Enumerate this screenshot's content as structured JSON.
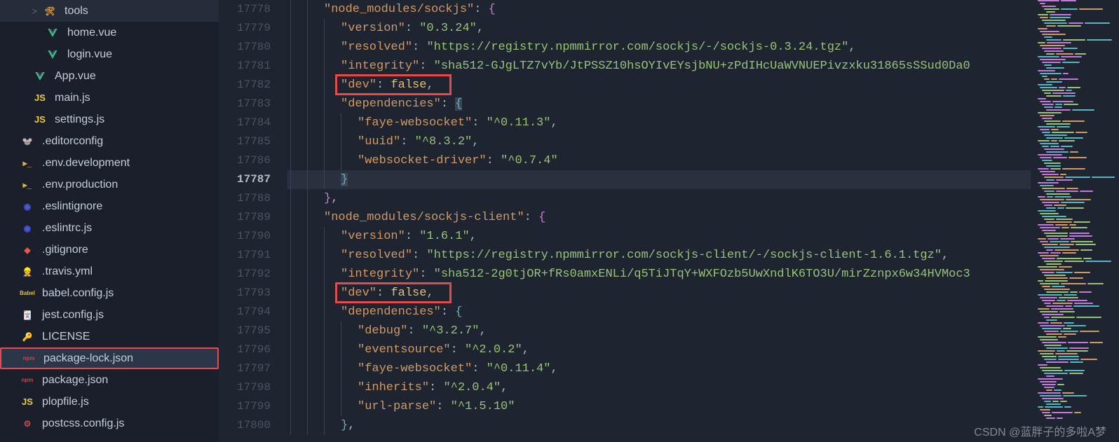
{
  "sidebar": {
    "items": [
      {
        "name": "tools",
        "icon": "tool",
        "indent": 1,
        "chev": ">",
        "active": false
      },
      {
        "name": "home.vue",
        "icon": "vue",
        "indent": 2,
        "active": false
      },
      {
        "name": "login.vue",
        "icon": "vue",
        "indent": 2,
        "active": false
      },
      {
        "name": "App.vue",
        "icon": "vue",
        "indent": 1,
        "active": false
      },
      {
        "name": "main.js",
        "icon": "js",
        "indent": 1,
        "active": false
      },
      {
        "name": "settings.js",
        "icon": "js",
        "indent": 1,
        "active": false
      },
      {
        "name": ".editorconfig",
        "icon": "editorconfig",
        "indent": 0,
        "active": false
      },
      {
        "name": ".env.development",
        "icon": "env",
        "indent": 0,
        "active": false
      },
      {
        "name": ".env.production",
        "icon": "env",
        "indent": 0,
        "active": false
      },
      {
        "name": ".eslintignore",
        "icon": "eslint",
        "indent": 0,
        "active": false
      },
      {
        "name": ".eslintrc.js",
        "icon": "eslint",
        "indent": 0,
        "active": false
      },
      {
        "name": ".gitignore",
        "icon": "git",
        "indent": 0,
        "active": false
      },
      {
        "name": ".travis.yml",
        "icon": "travis",
        "indent": 0,
        "active": false
      },
      {
        "name": "babel.config.js",
        "icon": "babel",
        "indent": 0,
        "active": false
      },
      {
        "name": "jest.config.js",
        "icon": "jest",
        "indent": 0,
        "active": false
      },
      {
        "name": "LICENSE",
        "icon": "license",
        "indent": 0,
        "active": false
      },
      {
        "name": "package-lock.json",
        "icon": "npm",
        "indent": 0,
        "active": true
      },
      {
        "name": "package.json",
        "icon": "npm",
        "indent": 0,
        "active": false
      },
      {
        "name": "plopfile.js",
        "icon": "js",
        "indent": 0,
        "active": false
      },
      {
        "name": "postcss.config.js",
        "icon": "postcss",
        "indent": 0,
        "active": false
      }
    ]
  },
  "lineStart": 17778,
  "currentLine": 17787,
  "code": [
    {
      "ind": 2,
      "tokens": [
        [
          "key",
          "\"node_modules/sockjs\""
        ],
        [
          "punc",
          ": "
        ],
        [
          "brace",
          "{"
        ]
      ]
    },
    {
      "ind": 3,
      "tokens": [
        [
          "key",
          "\"version\""
        ],
        [
          "punc",
          ": "
        ],
        [
          "str",
          "\"0.3.24\""
        ],
        [
          "punc",
          ","
        ]
      ]
    },
    {
      "ind": 3,
      "tokens": [
        [
          "key",
          "\"resolved\""
        ],
        [
          "punc",
          ": "
        ],
        [
          "str",
          "\"https://registry.npmmirror.com/sockjs/-/sockjs-0.3.24.tgz\""
        ],
        [
          "punc",
          ","
        ]
      ]
    },
    {
      "ind": 3,
      "tokens": [
        [
          "key",
          "\"integrity\""
        ],
        [
          "punc",
          ": "
        ],
        [
          "str",
          "\"sha512-GJgLTZ7vYb/JtPSSZ10hsOYIvEYsjbNU+zPdIHcUaWVNUEPivzxku31865sSSud0Da0"
        ]
      ]
    },
    {
      "ind": 3,
      "hl": true,
      "tokens": [
        [
          "key",
          "\"dev\""
        ],
        [
          "punc",
          ": "
        ],
        [
          "bool",
          "false"
        ],
        [
          "punc",
          ","
        ]
      ]
    },
    {
      "ind": 3,
      "tokens": [
        [
          "key",
          "\"dependencies\""
        ],
        [
          "punc",
          ": "
        ],
        [
          "brace2hl",
          "{"
        ]
      ]
    },
    {
      "ind": 4,
      "tokens": [
        [
          "key",
          "\"faye-websocket\""
        ],
        [
          "punc",
          ": "
        ],
        [
          "str",
          "\"^0.11.3\""
        ],
        [
          "punc",
          ","
        ]
      ]
    },
    {
      "ind": 4,
      "tokens": [
        [
          "key",
          "\"uuid\""
        ],
        [
          "punc",
          ": "
        ],
        [
          "str",
          "\"^8.3.2\""
        ],
        [
          "punc",
          ","
        ]
      ]
    },
    {
      "ind": 4,
      "tokens": [
        [
          "key",
          "\"websocket-driver\""
        ],
        [
          "punc",
          ": "
        ],
        [
          "str",
          "\"^0.7.4\""
        ]
      ]
    },
    {
      "ind": 3,
      "current": true,
      "tokens": [
        [
          "brace2hl",
          "}"
        ]
      ]
    },
    {
      "ind": 2,
      "tokens": [
        [
          "brace",
          "}"
        ],
        [
          "punc",
          ","
        ]
      ]
    },
    {
      "ind": 2,
      "tokens": [
        [
          "key",
          "\"node_modules/sockjs-client\""
        ],
        [
          "punc",
          ": "
        ],
        [
          "brace",
          "{"
        ]
      ]
    },
    {
      "ind": 3,
      "tokens": [
        [
          "key",
          "\"version\""
        ],
        [
          "punc",
          ": "
        ],
        [
          "str",
          "\"1.6.1\""
        ],
        [
          "punc",
          ","
        ]
      ]
    },
    {
      "ind": 3,
      "tokens": [
        [
          "key",
          "\"resolved\""
        ],
        [
          "punc",
          ": "
        ],
        [
          "str",
          "\"https://registry.npmmirror.com/sockjs-client/-/sockjs-client-1.6.1.tgz\""
        ],
        [
          "punc",
          ","
        ]
      ]
    },
    {
      "ind": 3,
      "tokens": [
        [
          "key",
          "\"integrity\""
        ],
        [
          "punc",
          ": "
        ],
        [
          "str",
          "\"sha512-2g0tjOR+fRs0amxENLi/q5TiJTqY+WXFOzb5UwXndlK6TO3U/mirZznpx6w34HVMoc3"
        ]
      ]
    },
    {
      "ind": 3,
      "hl": true,
      "tokens": [
        [
          "key",
          "\"dev\""
        ],
        [
          "punc",
          ": "
        ],
        [
          "bool",
          "false"
        ],
        [
          "punc",
          ","
        ]
      ]
    },
    {
      "ind": 3,
      "tokens": [
        [
          "key",
          "\"dependencies\""
        ],
        [
          "punc",
          ": "
        ],
        [
          "brace2",
          "{"
        ]
      ]
    },
    {
      "ind": 4,
      "tokens": [
        [
          "key",
          "\"debug\""
        ],
        [
          "punc",
          ": "
        ],
        [
          "str",
          "\"^3.2.7\""
        ],
        [
          "punc",
          ","
        ]
      ]
    },
    {
      "ind": 4,
      "tokens": [
        [
          "key",
          "\"eventsource\""
        ],
        [
          "punc",
          ": "
        ],
        [
          "str",
          "\"^2.0.2\""
        ],
        [
          "punc",
          ","
        ]
      ]
    },
    {
      "ind": 4,
      "tokens": [
        [
          "key",
          "\"faye-websocket\""
        ],
        [
          "punc",
          ": "
        ],
        [
          "str",
          "\"^0.11.4\""
        ],
        [
          "punc",
          ","
        ]
      ]
    },
    {
      "ind": 4,
      "tokens": [
        [
          "key",
          "\"inherits\""
        ],
        [
          "punc",
          ": "
        ],
        [
          "str",
          "\"^2.0.4\""
        ],
        [
          "punc",
          ","
        ]
      ]
    },
    {
      "ind": 4,
      "tokens": [
        [
          "key",
          "\"url-parse\""
        ],
        [
          "punc",
          ": "
        ],
        [
          "str",
          "\"^1.5.10\""
        ]
      ]
    },
    {
      "ind": 3,
      "tokens": [
        [
          "brace2",
          "}"
        ],
        [
          "punc",
          ","
        ]
      ]
    }
  ],
  "watermark": "CSDN @蓝胖子的多啦A梦"
}
